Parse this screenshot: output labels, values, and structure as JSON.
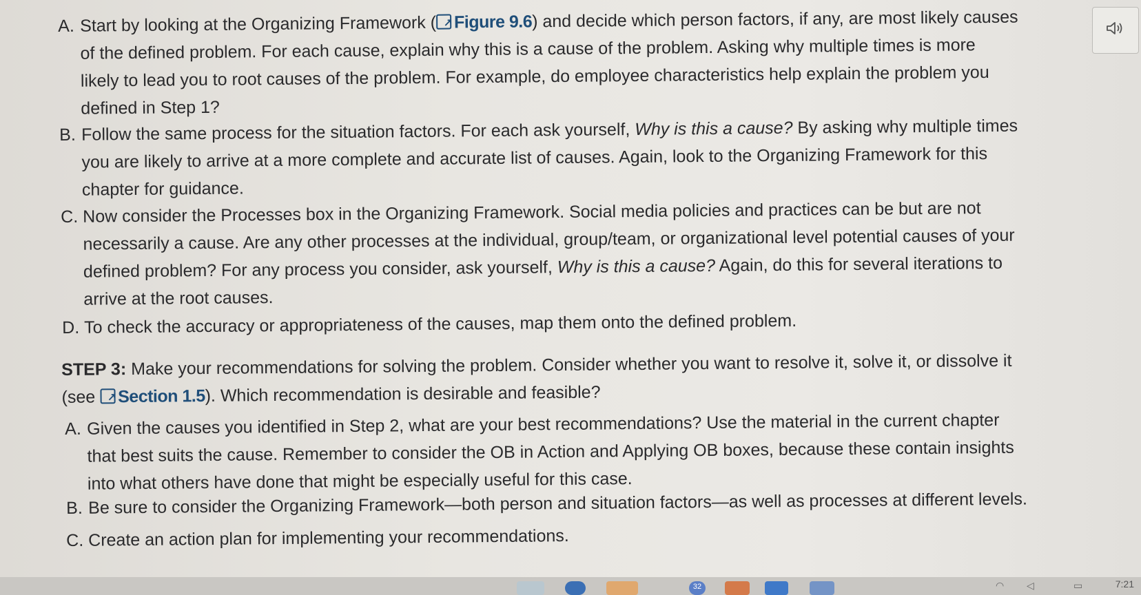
{
  "step2": {
    "a": {
      "marker": "A.",
      "line1_pre": "Start by looking at the Organizing Framework (",
      "line1_link": "Figure 9.6",
      "line1_post": ") and decide which person factors, if any, are most likely causes",
      "line2": "of the defined problem. For each cause, explain why this is a cause of the problem. Asking why multiple times is more",
      "line3": "likely to lead you to root causes of the problem. For example, do employee characteristics help explain the problem you",
      "line4": "defined in Step 1?"
    },
    "b": {
      "marker": "B.",
      "line1_pre": "Follow the same process for the situation factors. For each ask yourself, ",
      "line1_em": "Why is this a cause?",
      "line1_post": " By asking why multiple times",
      "line2": "you are likely to arrive at a more complete and accurate list of causes. Again, look to the Organizing Framework for this",
      "line3": "chapter for guidance."
    },
    "c": {
      "marker": "C.",
      "line1": "Now consider the Processes box in the Organizing Framework. Social media policies and practices can be but are not",
      "line2": "necessarily a cause. Are any other processes at the individual, group/team, or organizational level potential causes of your",
      "line3_pre": "defined problem? For any process you consider, ask yourself, ",
      "line3_em": "Why is this a cause?",
      "line3_post": " Again, do this for several iterations to",
      "line4": "arrive at the root causes."
    },
    "d": {
      "marker": "D.",
      "line1": "To check the accuracy or appropriateness of the causes, map them onto the defined problem."
    }
  },
  "step3": {
    "label": "STEP 3:",
    "line1": " Make your recommendations for solving the problem. Consider whether you want to resolve it, solve it, or dissolve it",
    "line2_pre": "(see ",
    "line2_link": "Section 1.5",
    "line2_post": "). Which recommendation is desirable and feasible?",
    "a": {
      "marker": "A.",
      "line1": "Given the causes you identified in Step 2, what are your best recommendations? Use the material in the current chapter",
      "line2": "that best suits the cause. Remember to consider the OB in Action and Applying OB boxes, because these contain insights",
      "line3": "into what others have done that might be especially useful for this case."
    },
    "b": {
      "marker": "B.",
      "line1": "Be sure to consider the Organizing Framework—both person and situation factors—as well as processes at different levels."
    },
    "c": {
      "marker": "C.",
      "line1": "Create an action plan for implementing your recommendations."
    }
  },
  "speaker_icon": "speaker-icon",
  "taskbar": {
    "clock": "7:21",
    "badge": "32"
  }
}
